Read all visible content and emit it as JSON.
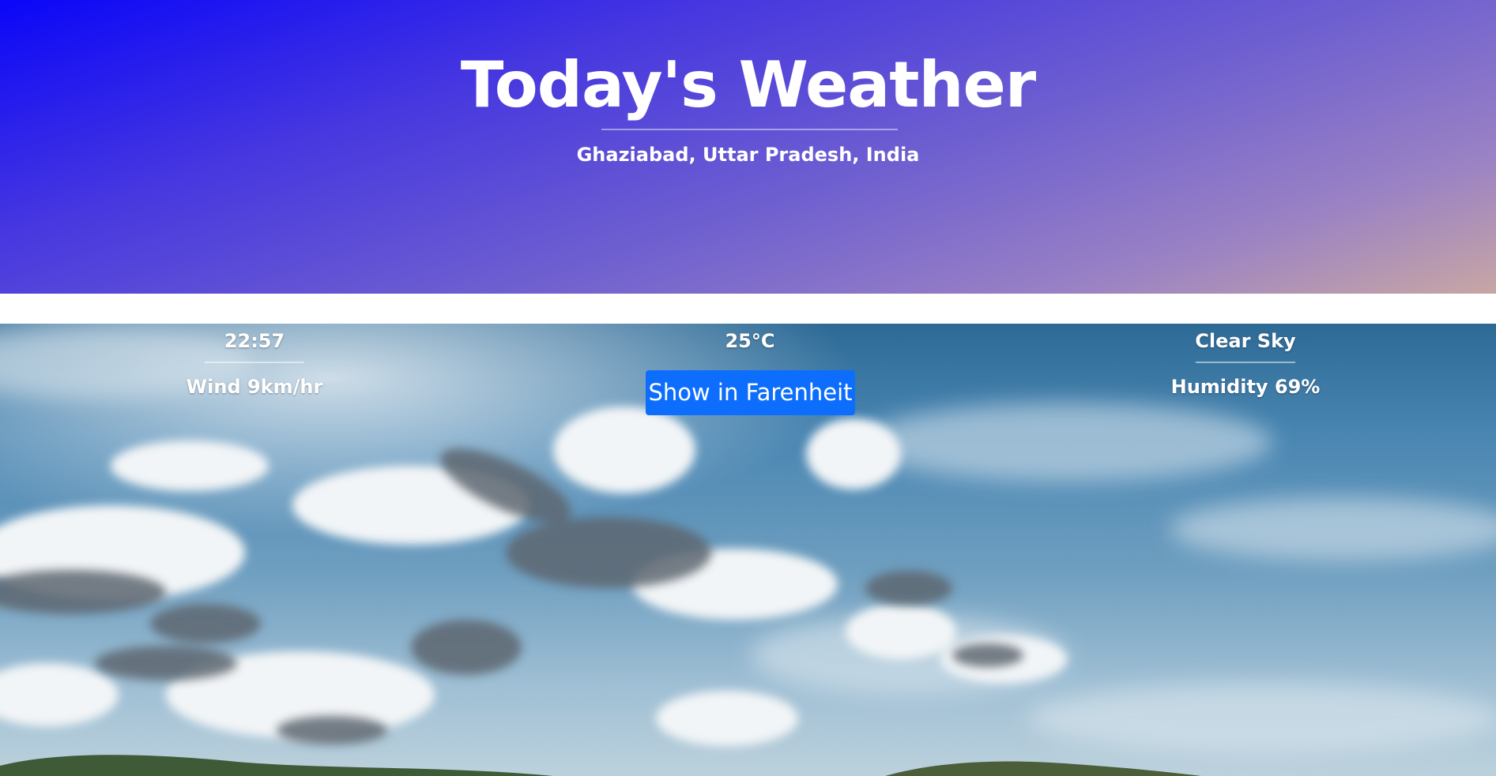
{
  "header": {
    "title": "Today's Weather",
    "location": "Ghaziabad, Uttar Pradesh, India"
  },
  "weather": {
    "time": "22:57",
    "wind": "Wind 9km/hr",
    "temperature": "25°C",
    "toggle_button_label": "Show in Farenheit",
    "condition": "Clear Sky",
    "humidity": "Humidity 69%"
  },
  "colors": {
    "button": "#0d6efd",
    "header_gradient_start": "#0a06f8",
    "header_gradient_end": "#c8a6a4"
  }
}
